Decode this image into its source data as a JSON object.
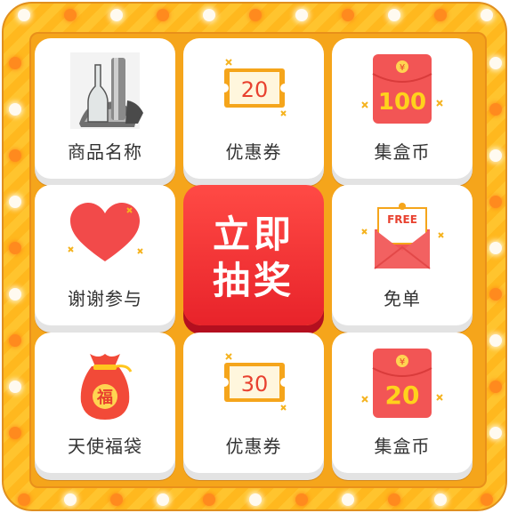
{
  "prizes": [
    {
      "label": "商品名称"
    },
    {
      "label": "优惠券",
      "value": "20"
    },
    {
      "label": "集盒币",
      "value": "100",
      "currency": "¥"
    },
    {
      "label": "谢谢参与"
    },
    {
      "label": "免单",
      "tag": "FREE"
    },
    {
      "label": "天使福袋",
      "mark": "福"
    },
    {
      "label": "优惠券",
      "value": "30"
    },
    {
      "label": "集盒币",
      "value": "20",
      "currency": "¥"
    }
  ],
  "draw_button": {
    "line1": "立即",
    "line2": "抽奖"
  },
  "colors": {
    "accent": "#ff2d36",
    "gold": "#ffc42e",
    "ticket": "#f5a51b",
    "envelope": "#f25555"
  }
}
